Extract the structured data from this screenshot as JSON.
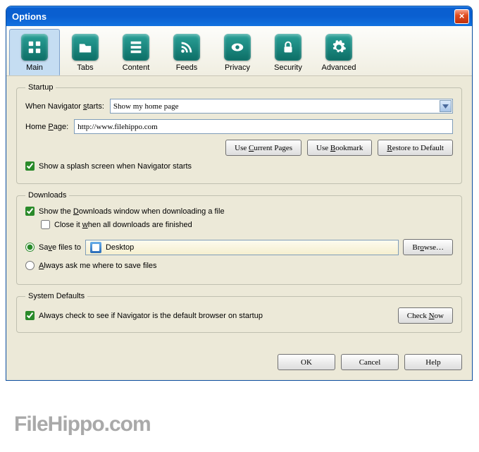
{
  "window": {
    "title": "Options"
  },
  "tabs": [
    {
      "id": "main",
      "label": "Main"
    },
    {
      "id": "tabs",
      "label": "Tabs"
    },
    {
      "id": "content",
      "label": "Content"
    },
    {
      "id": "feeds",
      "label": "Feeds"
    },
    {
      "id": "privacy",
      "label": "Privacy"
    },
    {
      "id": "security",
      "label": "Security"
    },
    {
      "id": "advanced",
      "label": "Advanced"
    }
  ],
  "startup": {
    "legend": "Startup",
    "when_label_pre": "When Navigator ",
    "when_label_u": "s",
    "when_label_post": "tarts:",
    "when_value": "Show my home page",
    "home_label": "Home ",
    "home_label_u": "P",
    "home_label_post": "age:",
    "home_value": "http://www.filehippo.com",
    "btn_current_pre": "Use ",
    "btn_current_u": "C",
    "btn_current_post": "urrent Pages",
    "btn_bookmark_pre": "Use ",
    "btn_bookmark_u": "B",
    "btn_bookmark_post": "ookmark",
    "btn_restore_u": "R",
    "btn_restore_post": "estore to Default",
    "splash_label": "Show a splash screen when Navigator starts",
    "splash_checked": true
  },
  "downloads": {
    "legend": "Downloads",
    "show_pre": "Show the ",
    "show_u": "D",
    "show_post": "ownloads window when downloading a file",
    "show_checked": true,
    "close_pre": "Close it ",
    "close_u": "w",
    "close_post": "hen all downloads are finished",
    "close_checked": false,
    "save_pre": "Sa",
    "save_u": "v",
    "save_post": "e files to",
    "save_selected": true,
    "save_path": "Desktop",
    "browse_pre": "Br",
    "browse_u": "o",
    "browse_post": "wse…",
    "ask_u": "A",
    "ask_post": "lways ask me where to save files",
    "ask_selected": false
  },
  "defaults": {
    "legend": "System Defaults",
    "always_label": "Always check to see if Navigator is the default browser on startup",
    "always_checked": true,
    "check_pre": "Check ",
    "check_u": "N",
    "check_post": "ow"
  },
  "footer": {
    "ok": "OK",
    "cancel": "Cancel",
    "help": "Help"
  },
  "watermark": "FileHippo.com"
}
